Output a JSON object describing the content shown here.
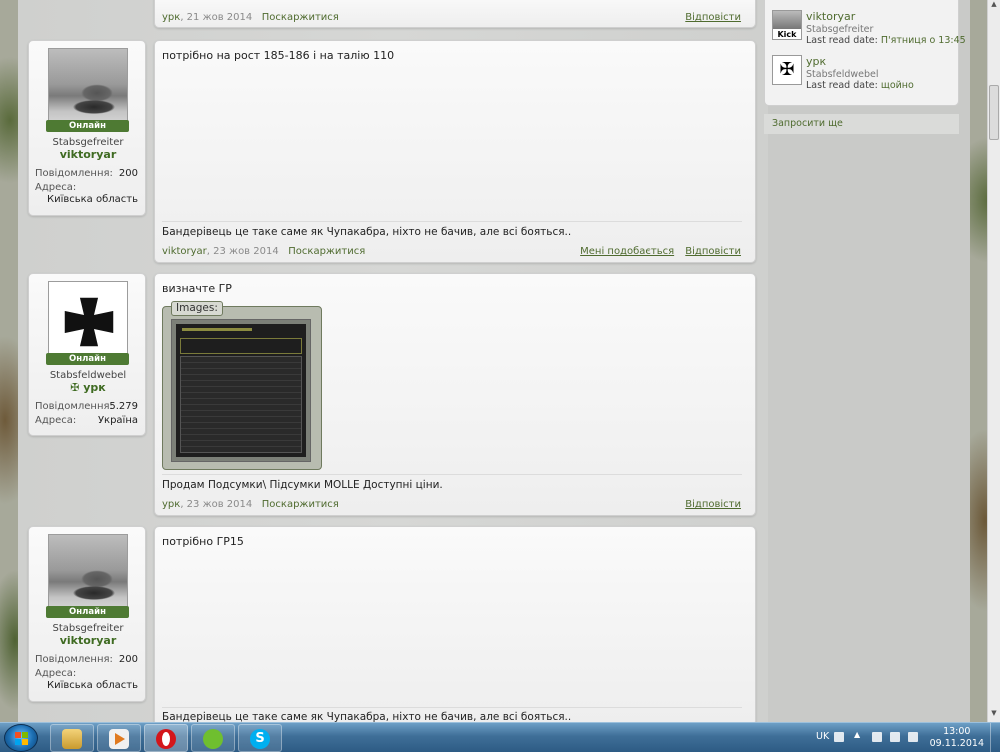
{
  "post0": {
    "author": "урк",
    "date": "21 жов 2014",
    "report": "Поскаржитися",
    "reply": "Відповісти"
  },
  "post1": {
    "user": {
      "online": "Онлайн",
      "rank": "Stabsgefreiter",
      "name": "viktoryar",
      "messages_label": "Повідомлення:",
      "messages": "200",
      "address_label": "Адреса:",
      "address": "Київська область"
    },
    "body": "потрібно на рост 185-186 і на талію 110",
    "signature": "Бандерівець це таке саме як Чупакабра, ніхто не бачив, але всі бояться..",
    "author": "viktoryar",
    "date": "23 жов 2014",
    "report": "Поскаржитися",
    "like": "Мені подобається",
    "reply": "Відповісти"
  },
  "post2": {
    "user": {
      "online": "Онлайн",
      "rank": "Stabsfeldwebel",
      "name": "✠ урк",
      "messages_label": "Повідомлення:",
      "messages": "5.279",
      "address_label": "Адреса:",
      "address": "Україна"
    },
    "body": "визначте ГР",
    "images_label": "Images:",
    "signature": "Продам Подсумки\\ Підсумки MOLLE Доступні ціни.",
    "author": "урк",
    "date": "23 жов 2014",
    "report": "Поскаржитися",
    "reply": "Відповісти"
  },
  "post3": {
    "user": {
      "online": "Онлайн",
      "rank": "Stabsgefreiter",
      "name": "viktoryar",
      "messages_label": "Повідомлення:",
      "messages": "200",
      "address_label": "Адреса:",
      "address": "Київська область"
    },
    "body": "потрібно ГР15",
    "signature": "Бандерівець це таке саме як Чупакабра, ніхто не бачив, але всі бояться.."
  },
  "sidebar": {
    "readers": [
      {
        "avatar_text": "Kick",
        "name": "viktoryar",
        "rank": "Stabsgefreiter",
        "last_read_label": "Last read date:",
        "last_read": "П'ятниця о 13:45"
      },
      {
        "avatar_text": "✠",
        "name": "урк",
        "rank": "Stabsfeldwebel",
        "last_read_label": "Last read date:",
        "last_read": "щойно"
      }
    ],
    "invite": "Запросити ще"
  },
  "taskbar": {
    "lang": "UK",
    "time": "13:00",
    "date": "09.11.2014"
  }
}
